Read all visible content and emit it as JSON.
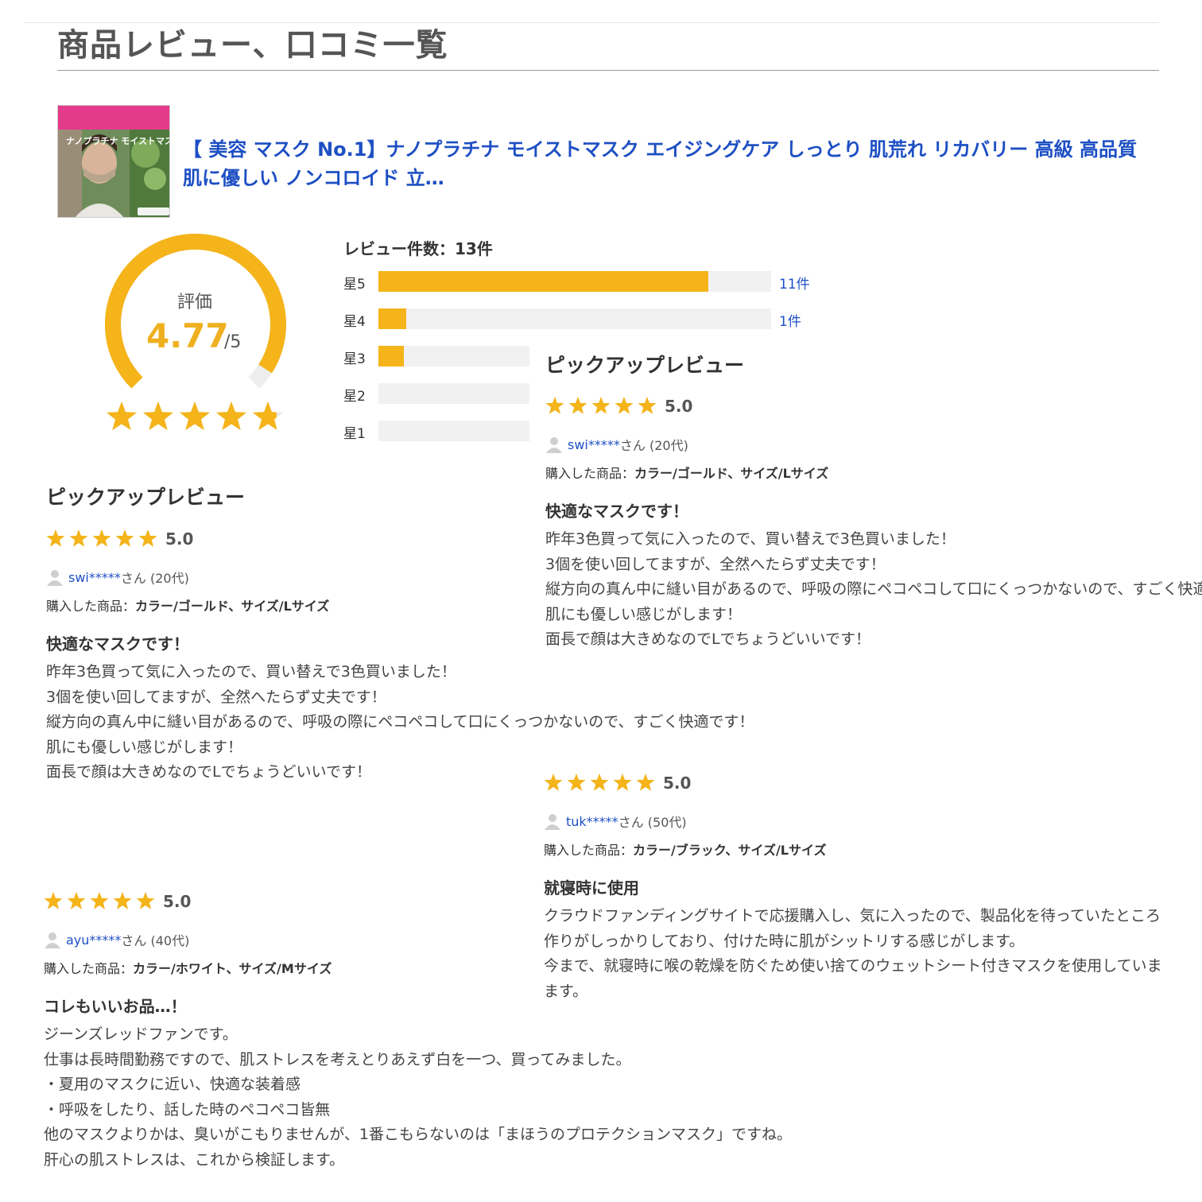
{
  "page": {
    "title": "商品レビュー、口コミ一覧"
  },
  "product": {
    "title": "【 美容 マスク No.1】ナノプラチナ モイストマスク エイジングケア しっとり 肌荒れ リカバリー 高級 高品質 肌に優しい ノンコロイド 立…",
    "thumbnail_text": "ナノプラチナ モイストマスク"
  },
  "summary": {
    "label": "評価",
    "score": "4.77",
    "of": "/5",
    "rating": 4.77,
    "review_count_label": "レビュー件数：13件",
    "distribution": [
      {
        "label": "星5",
        "count_text": "11件",
        "fraction": 0.84
      },
      {
        "label": "星4",
        "count_text": "1件",
        "fraction": 0.07
      },
      {
        "label": "星3",
        "count_text": "",
        "fraction": 0.17
      },
      {
        "label": "星2",
        "count_text": "",
        "fraction": 0
      },
      {
        "label": "星1",
        "count_text": "",
        "fraction": 0
      }
    ]
  },
  "colors": {
    "accent": "#f4b41a",
    "link": "#1d4fc4",
    "track": "#f1f1f1"
  },
  "pickup": {
    "title": "ピックアップレビュー",
    "reviews": [
      {
        "score": "5.0",
        "name": "swi*****",
        "suffix": "さん (20代)",
        "product_label": "購入した商品：",
        "product_value": "カラー/ゴールド、サイズ/Lサイズ",
        "heading": "快適なマスクです！",
        "lines": [
          "昨年3色買って気に入ったので、買い替えで3色買いました！",
          "3個を使い回してますが、全然へたらず丈夫です！",
          "縦方向の真ん中に縫い目があるので、呼吸の際にペコペコして口にくっつかないので、すごく快適です！",
          "肌にも優しい感じがします！",
          "面長で顔は大きめなのでLでちょうどいいです！"
        ]
      },
      {
        "score": "5.0",
        "name": "tuk*****",
        "suffix": "さん (50代)",
        "product_label": "購入した商品：",
        "product_value": "カラー/ブラック、サイズ/Lサイズ",
        "heading": "就寝時に使用",
        "lines": [
          "クラウドファンディングサイトで応援購入し、気に入ったので、製品化を待っていたところ",
          "作りがしっかりしており、付けた時に肌がシットリする感じがします。",
          "今まで、就寝時に喉の乾燥を防ぐため使い捨てのウェットシート付きマスクを使用していま",
          "ます。"
        ]
      },
      {
        "score": "5.0",
        "name": "ayu*****",
        "suffix": "さん (40代)",
        "product_label": "購入した商品：",
        "product_value": "カラー/ホワイト、サイズ/Mサイズ",
        "heading": "コレもいいお品…！",
        "lines": [
          "ジーンズレッドファンです。",
          "仕事は長時間勤務ですので、肌ストレスを考えとりあえず白を一つ、買ってみました。",
          "・夏用のマスクに近い、快適な装着感",
          "・呼吸をしたり、話した時のペコペコ皆無",
          "他のマスクよりかは、臭いがこもりませんが、1番こもらないのは「まほうのプロテクションマスク」ですね。",
          "肝心の肌ストレスは、これから検証します。"
        ]
      }
    ]
  }
}
